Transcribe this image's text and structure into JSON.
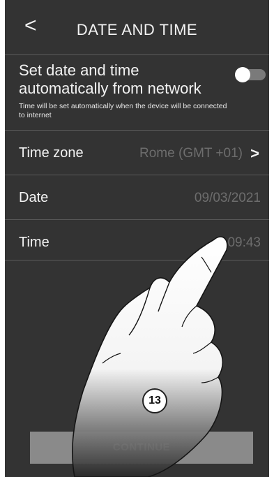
{
  "header": {
    "title": "DATE AND TIME",
    "back_icon": "<"
  },
  "auto_setting": {
    "title": "Set date and time automatically from network",
    "note": "Time will be set automatically when the device will be connected to internet",
    "toggle_state": "off"
  },
  "rows": [
    {
      "label": "Time zone",
      "value": "Rome (GMT +01)",
      "chevron": ">"
    },
    {
      "label": "Date",
      "value": "09/03/2021"
    },
    {
      "label": "Time",
      "value": "09:43"
    }
  ],
  "step_badge": "13",
  "continue_label": "CONTINUE",
  "colors": {
    "background": "#333333",
    "text": "#f2f2f2",
    "muted": "#6d6d6d",
    "button": "#8a8a8a"
  }
}
